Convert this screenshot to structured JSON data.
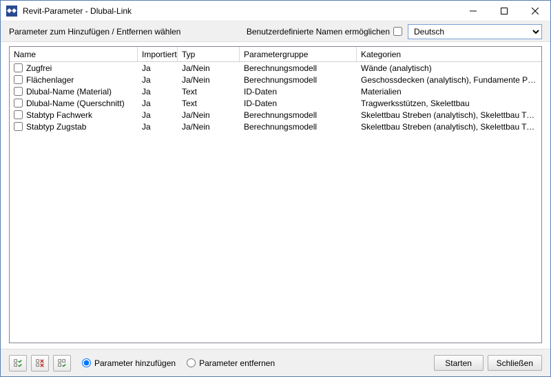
{
  "window": {
    "title": "Revit-Parameter - Dlubal-Link"
  },
  "topstrip": {
    "left_label": "Parameter zum Hinzufügen / Entfernen wählen",
    "udn_label": "Benutzerdefinierte Namen ermöglichen",
    "udn_checked": false,
    "language_selected": "Deutsch",
    "language_options": [
      "Deutsch"
    ]
  },
  "table": {
    "headers": {
      "name": "Name",
      "imported": "Importiert",
      "type": "Typ",
      "param_group": "Parametergruppe",
      "categories": "Kategorien"
    },
    "rows": [
      {
        "checked": false,
        "name": "Zugfrei",
        "imported": "Ja",
        "type": "Ja/Nein",
        "param_group": "Berechnungsmodell",
        "categories": "Wände (analytisch)"
      },
      {
        "checked": false,
        "name": "Flächenlager",
        "imported": "Ja",
        "type": "Ja/Nein",
        "param_group": "Berechnungsmodell",
        "categories": "Geschossdecken (analytisch), Fundamente Platte (ana..."
      },
      {
        "checked": false,
        "name": "Dlubal-Name (Material)",
        "imported": "Ja",
        "type": "Text",
        "param_group": "ID-Daten",
        "categories": "Materialien"
      },
      {
        "checked": false,
        "name": "Dlubal-Name (Querschnitt)",
        "imported": "Ja",
        "type": "Text",
        "param_group": "ID-Daten",
        "categories": "Tragwerksstützen, Skelettbau"
      },
      {
        "checked": false,
        "name": "Stabtyp Fachwerk",
        "imported": "Ja",
        "type": "Ja/Nein",
        "param_group": "Berechnungsmodell",
        "categories": "Skelettbau Streben (analytisch), Skelettbau Träger (an..."
      },
      {
        "checked": false,
        "name": "Stabtyp Zugstab",
        "imported": "Ja",
        "type": "Ja/Nein",
        "param_group": "Berechnungsmodell",
        "categories": "Skelettbau Streben (analytisch), Skelettbau Träger (an..."
      }
    ]
  },
  "bottom": {
    "radio_add": "Parameter hinzufügen",
    "radio_remove": "Parameter entfernen",
    "radio_selected": "add",
    "start": "Starten",
    "close": "Schließen"
  }
}
